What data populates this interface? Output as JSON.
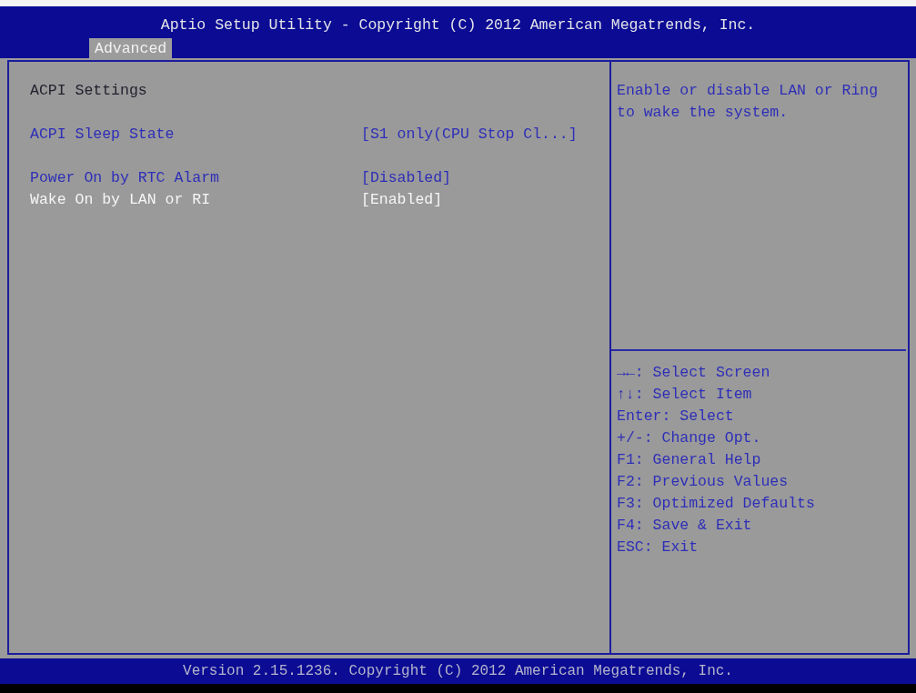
{
  "header": {
    "title": "Aptio Setup Utility - Copyright (C) 2012 American Megatrends, Inc.",
    "tabs": [
      {
        "label": "Advanced",
        "selected": true
      }
    ]
  },
  "settings_panel": {
    "heading": "ACPI Settings",
    "groups": [
      {
        "items": [
          {
            "label": "ACPI Sleep State",
            "value": "[S1 only(CPU Stop Cl...]",
            "selected": false
          }
        ]
      },
      {
        "items": [
          {
            "label": "Power On by RTC Alarm",
            "value": "[Disabled]",
            "selected": false
          },
          {
            "label": "Wake On by LAN or RI",
            "value": "[Enabled]",
            "selected": true
          }
        ]
      }
    ]
  },
  "help_panel": {
    "description": "Enable or disable LAN or Ring to wake the system.",
    "key_hints": [
      "→←: Select Screen",
      "↑↓: Select Item",
      "Enter: Select",
      "+/-: Change Opt.",
      "F1: General Help",
      "F2: Previous Values",
      "F3: Optimized Defaults",
      "F4: Save & Exit",
      "ESC: Exit"
    ]
  },
  "footer": {
    "text": "Version 2.15.1236. Copyright (C) 2012 American Megatrends, Inc."
  }
}
